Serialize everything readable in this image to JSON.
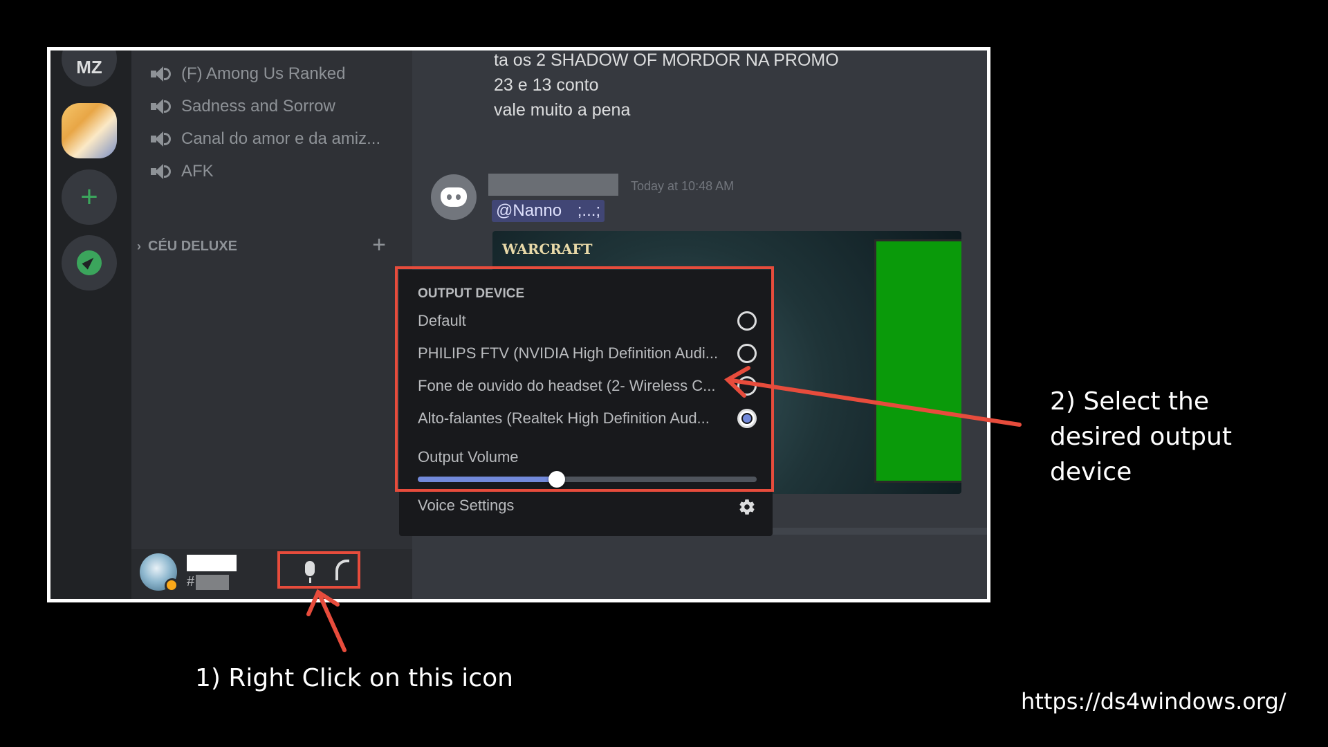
{
  "rail": {
    "initials": "MZ"
  },
  "channels": {
    "voice": [
      {
        "label": "(F) Among Us Ranked"
      },
      {
        "label": "Sadness and Sorrow"
      },
      {
        "label": "Canal do amor e da amiz..."
      },
      {
        "label": "AFK"
      }
    ],
    "category": "CÉU DELUXE"
  },
  "user": {
    "tag_prefix": "#"
  },
  "chat": {
    "messages": [
      "ta os 2 SHADOW OF MORDOR NA PROMO",
      "23 e 13 conto",
      "vale muito a pena"
    ],
    "timestamp": "Today at 10:48 AM",
    "mention": "@Nanno",
    "mention_suffix": ";...;",
    "embed_logo": "WARCRAFT"
  },
  "popout": {
    "title": "OUTPUT DEVICE",
    "devices": [
      {
        "label": "Default",
        "selected": false
      },
      {
        "label": "PHILIPS FTV (NVIDIA High Definition Audi...",
        "selected": false
      },
      {
        "label": "Fone de ouvido do headset (2- Wireless C...",
        "selected": false
      },
      {
        "label": "Alto-falantes (Realtek High Definition Aud...",
        "selected": true
      }
    ],
    "volume_label": "Output Volume",
    "volume_fraction": 0.41,
    "voice_settings_label": "Voice Settings"
  },
  "annotations": {
    "step1": "1) Right Click on this icon",
    "step2": "2) Select the desired output device",
    "source": "https://ds4windows.org/"
  },
  "colors": {
    "highlight": "#e74c3c",
    "accent": "#7289da",
    "online_green": "#3ba55c"
  }
}
